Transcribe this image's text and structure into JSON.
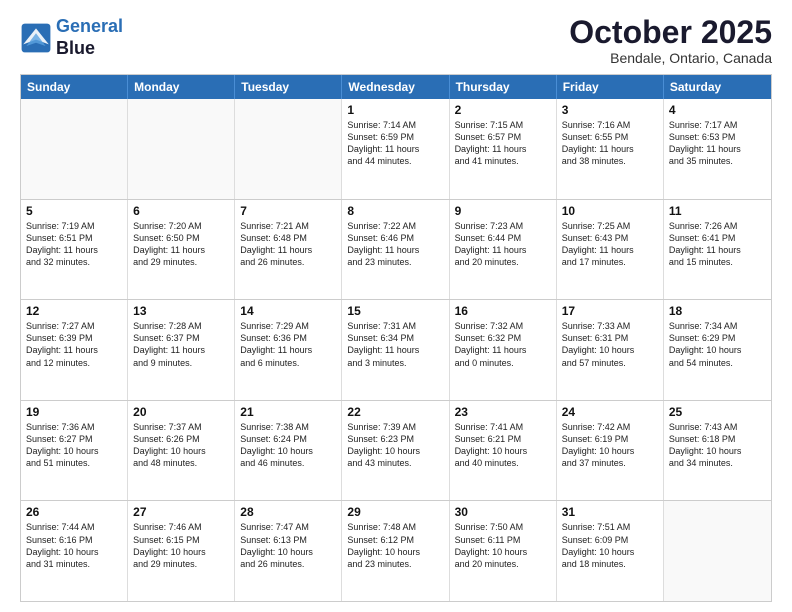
{
  "header": {
    "logo_line1": "General",
    "logo_line2": "Blue",
    "month_title": "October 2025",
    "subtitle": "Bendale, Ontario, Canada"
  },
  "day_headers": [
    "Sunday",
    "Monday",
    "Tuesday",
    "Wednesday",
    "Thursday",
    "Friday",
    "Saturday"
  ],
  "rows": [
    [
      {
        "day": "",
        "info": ""
      },
      {
        "day": "",
        "info": ""
      },
      {
        "day": "",
        "info": ""
      },
      {
        "day": "1",
        "info": "Sunrise: 7:14 AM\nSunset: 6:59 PM\nDaylight: 11 hours\nand 44 minutes."
      },
      {
        "day": "2",
        "info": "Sunrise: 7:15 AM\nSunset: 6:57 PM\nDaylight: 11 hours\nand 41 minutes."
      },
      {
        "day": "3",
        "info": "Sunrise: 7:16 AM\nSunset: 6:55 PM\nDaylight: 11 hours\nand 38 minutes."
      },
      {
        "day": "4",
        "info": "Sunrise: 7:17 AM\nSunset: 6:53 PM\nDaylight: 11 hours\nand 35 minutes."
      }
    ],
    [
      {
        "day": "5",
        "info": "Sunrise: 7:19 AM\nSunset: 6:51 PM\nDaylight: 11 hours\nand 32 minutes."
      },
      {
        "day": "6",
        "info": "Sunrise: 7:20 AM\nSunset: 6:50 PM\nDaylight: 11 hours\nand 29 minutes."
      },
      {
        "day": "7",
        "info": "Sunrise: 7:21 AM\nSunset: 6:48 PM\nDaylight: 11 hours\nand 26 minutes."
      },
      {
        "day": "8",
        "info": "Sunrise: 7:22 AM\nSunset: 6:46 PM\nDaylight: 11 hours\nand 23 minutes."
      },
      {
        "day": "9",
        "info": "Sunrise: 7:23 AM\nSunset: 6:44 PM\nDaylight: 11 hours\nand 20 minutes."
      },
      {
        "day": "10",
        "info": "Sunrise: 7:25 AM\nSunset: 6:43 PM\nDaylight: 11 hours\nand 17 minutes."
      },
      {
        "day": "11",
        "info": "Sunrise: 7:26 AM\nSunset: 6:41 PM\nDaylight: 11 hours\nand 15 minutes."
      }
    ],
    [
      {
        "day": "12",
        "info": "Sunrise: 7:27 AM\nSunset: 6:39 PM\nDaylight: 11 hours\nand 12 minutes."
      },
      {
        "day": "13",
        "info": "Sunrise: 7:28 AM\nSunset: 6:37 PM\nDaylight: 11 hours\nand 9 minutes."
      },
      {
        "day": "14",
        "info": "Sunrise: 7:29 AM\nSunset: 6:36 PM\nDaylight: 11 hours\nand 6 minutes."
      },
      {
        "day": "15",
        "info": "Sunrise: 7:31 AM\nSunset: 6:34 PM\nDaylight: 11 hours\nand 3 minutes."
      },
      {
        "day": "16",
        "info": "Sunrise: 7:32 AM\nSunset: 6:32 PM\nDaylight: 11 hours\nand 0 minutes."
      },
      {
        "day": "17",
        "info": "Sunrise: 7:33 AM\nSunset: 6:31 PM\nDaylight: 10 hours\nand 57 minutes."
      },
      {
        "day": "18",
        "info": "Sunrise: 7:34 AM\nSunset: 6:29 PM\nDaylight: 10 hours\nand 54 minutes."
      }
    ],
    [
      {
        "day": "19",
        "info": "Sunrise: 7:36 AM\nSunset: 6:27 PM\nDaylight: 10 hours\nand 51 minutes."
      },
      {
        "day": "20",
        "info": "Sunrise: 7:37 AM\nSunset: 6:26 PM\nDaylight: 10 hours\nand 48 minutes."
      },
      {
        "day": "21",
        "info": "Sunrise: 7:38 AM\nSunset: 6:24 PM\nDaylight: 10 hours\nand 46 minutes."
      },
      {
        "day": "22",
        "info": "Sunrise: 7:39 AM\nSunset: 6:23 PM\nDaylight: 10 hours\nand 43 minutes."
      },
      {
        "day": "23",
        "info": "Sunrise: 7:41 AM\nSunset: 6:21 PM\nDaylight: 10 hours\nand 40 minutes."
      },
      {
        "day": "24",
        "info": "Sunrise: 7:42 AM\nSunset: 6:19 PM\nDaylight: 10 hours\nand 37 minutes."
      },
      {
        "day": "25",
        "info": "Sunrise: 7:43 AM\nSunset: 6:18 PM\nDaylight: 10 hours\nand 34 minutes."
      }
    ],
    [
      {
        "day": "26",
        "info": "Sunrise: 7:44 AM\nSunset: 6:16 PM\nDaylight: 10 hours\nand 31 minutes."
      },
      {
        "day": "27",
        "info": "Sunrise: 7:46 AM\nSunset: 6:15 PM\nDaylight: 10 hours\nand 29 minutes."
      },
      {
        "day": "28",
        "info": "Sunrise: 7:47 AM\nSunset: 6:13 PM\nDaylight: 10 hours\nand 26 minutes."
      },
      {
        "day": "29",
        "info": "Sunrise: 7:48 AM\nSunset: 6:12 PM\nDaylight: 10 hours\nand 23 minutes."
      },
      {
        "day": "30",
        "info": "Sunrise: 7:50 AM\nSunset: 6:11 PM\nDaylight: 10 hours\nand 20 minutes."
      },
      {
        "day": "31",
        "info": "Sunrise: 7:51 AM\nSunset: 6:09 PM\nDaylight: 10 hours\nand 18 minutes."
      },
      {
        "day": "",
        "info": ""
      }
    ]
  ]
}
